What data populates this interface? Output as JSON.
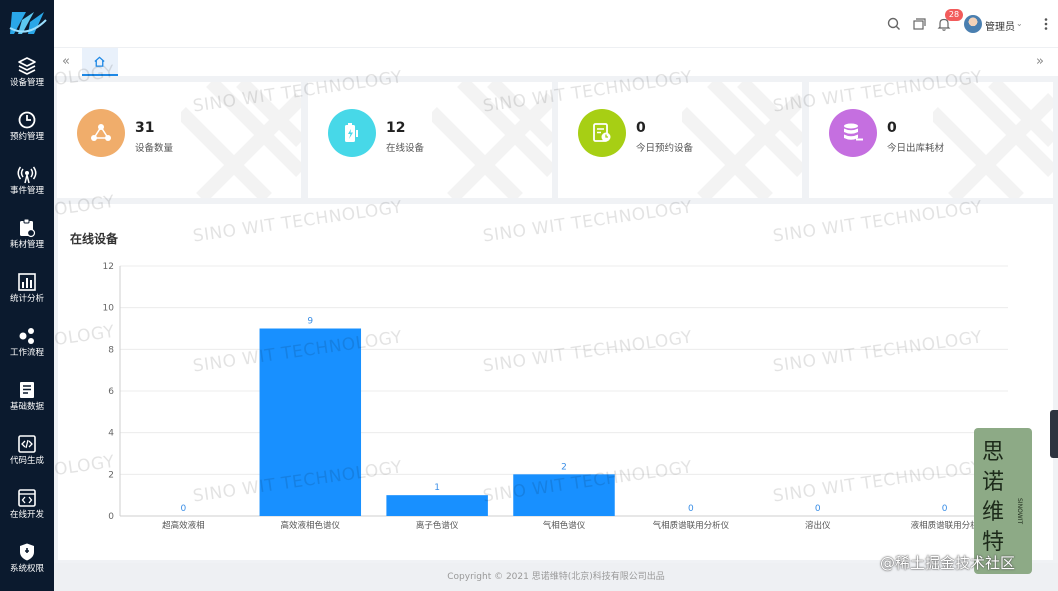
{
  "header": {
    "notification_count": "28",
    "user_name": "管理员",
    "icons": [
      "search-icon",
      "window-icon",
      "bell-icon",
      "more-icon"
    ]
  },
  "sidebar": {
    "items": [
      {
        "label": "设备管理",
        "icon": "layers-icon"
      },
      {
        "label": "预约管理",
        "icon": "clock-icon"
      },
      {
        "label": "事件管理",
        "icon": "signal-icon"
      },
      {
        "label": "耗材管理",
        "icon": "clipboard-icon"
      },
      {
        "label": "统计分析",
        "icon": "bar-chart-icon"
      },
      {
        "label": "工作流程",
        "icon": "share-icon"
      },
      {
        "label": "基础数据",
        "icon": "document-icon"
      },
      {
        "label": "代码生成",
        "icon": "code-icon"
      },
      {
        "label": "在线开发",
        "icon": "code-window-icon"
      },
      {
        "label": "系统权限",
        "icon": "shield-icon"
      }
    ]
  },
  "tabs": {
    "home_icon": "home-icon"
  },
  "stats": [
    {
      "value": "31",
      "label": "设备数量",
      "color": "#f0ad6b"
    },
    {
      "value": "12",
      "label": "在线设备",
      "color": "#47d8e8"
    },
    {
      "value": "0",
      "label": "今日预约设备",
      "color": "#a7cf14"
    },
    {
      "value": "0",
      "label": "今日出库耗材",
      "color": "#c56fe0"
    }
  ],
  "chart": {
    "title": "在线设备"
  },
  "chart_data": {
    "type": "bar",
    "categories": [
      "超高效液相",
      "高效液相色谱仪",
      "离子色谱仪",
      "气相色谱仪",
      "气相质谱联用分析仪",
      "溶出仪",
      "液相质谱联用分析"
    ],
    "values": [
      0,
      9,
      1,
      2,
      0,
      0,
      0
    ],
    "ylim": [
      0,
      12
    ],
    "yticks": [
      0,
      2,
      4,
      6,
      8,
      10,
      12
    ],
    "color": "#1890ff",
    "grid": true
  },
  "footer": {
    "text": "Copyright © 2021 思诺维特(北京)科技有限公司出品"
  },
  "watermark": "SINO WIT TECHNOLOGY",
  "watermark_partial": "OLOGY",
  "sticker": {
    "chars": [
      "思",
      "诺",
      "维",
      "特"
    ],
    "side_text": "SINOWIT"
  },
  "corner_mark": "@稀土掘金技术社区"
}
